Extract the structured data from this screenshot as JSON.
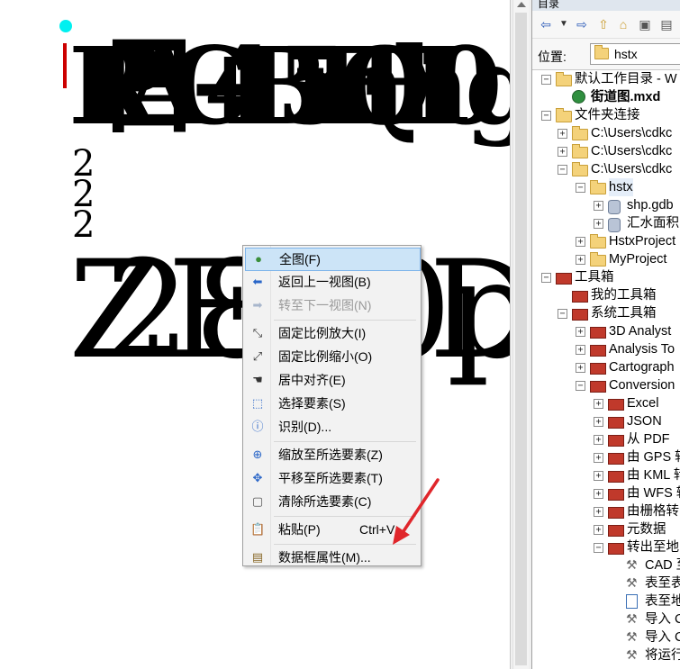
{
  "catalog": {
    "title": "目录",
    "location_label": "位置:",
    "location_value": "hstx",
    "tree": [
      {
        "label": "默认工作目录 - W",
        "level": 0,
        "expander": "−",
        "icon": "home-folder-icon"
      },
      {
        "label": "街道图.mxd",
        "level": 1,
        "expander": "",
        "icon": "map-document-icon",
        "bold": true
      },
      {
        "label": "文件夹连接",
        "level": 0,
        "expander": "−",
        "icon": "folder-connections-icon"
      },
      {
        "label": "C:\\Users\\cdkc",
        "level": 1,
        "expander": "+",
        "icon": "folder-icon"
      },
      {
        "label": "C:\\Users\\cdkc",
        "level": 1,
        "expander": "+",
        "icon": "folder-icon"
      },
      {
        "label": "C:\\Users\\cdkc",
        "level": 1,
        "expander": "−",
        "icon": "folder-icon"
      },
      {
        "label": "hstx",
        "level": 2,
        "expander": "−",
        "icon": "folder-open-icon",
        "selected": true
      },
      {
        "label": "shp.gdb",
        "level": 3,
        "expander": "+",
        "icon": "geodatabase-icon"
      },
      {
        "label": "汇水面积",
        "level": 3,
        "expander": "+",
        "icon": "dataset-icon"
      },
      {
        "label": "HstxProject",
        "level": 2,
        "expander": "+",
        "icon": "folder-icon"
      },
      {
        "label": "MyProject",
        "level": 2,
        "expander": "+",
        "icon": "folder-icon"
      },
      {
        "label": "工具箱",
        "level": 0,
        "expander": "−",
        "icon": "toolbox-icon"
      },
      {
        "label": "我的工具箱",
        "level": 1,
        "expander": "",
        "icon": "toolbox-icon"
      },
      {
        "label": "系统工具箱",
        "level": 1,
        "expander": "−",
        "icon": "toolbox-icon"
      },
      {
        "label": "3D Analyst",
        "level": 2,
        "expander": "+",
        "icon": "toolbox-icon"
      },
      {
        "label": "Analysis To",
        "level": 2,
        "expander": "+",
        "icon": "toolbox-icon"
      },
      {
        "label": "Cartograph",
        "level": 2,
        "expander": "+",
        "icon": "toolbox-icon"
      },
      {
        "label": "Conversion",
        "level": 2,
        "expander": "−",
        "icon": "toolbox-icon"
      },
      {
        "label": "Excel",
        "level": 3,
        "expander": "+",
        "icon": "toolset-icon"
      },
      {
        "label": "JSON",
        "level": 3,
        "expander": "+",
        "icon": "toolset-icon"
      },
      {
        "label": "从 PDF",
        "level": 3,
        "expander": "+",
        "icon": "toolset-icon"
      },
      {
        "label": "由 GPS 转",
        "level": 3,
        "expander": "+",
        "icon": "toolset-icon"
      },
      {
        "label": "由 KML 转",
        "level": 3,
        "expander": "+",
        "icon": "toolset-icon"
      },
      {
        "label": "由 WFS 转",
        "level": 3,
        "expander": "+",
        "icon": "toolset-icon"
      },
      {
        "label": "由栅格转",
        "level": 3,
        "expander": "+",
        "icon": "toolset-icon"
      },
      {
        "label": "元数据",
        "level": 3,
        "expander": "+",
        "icon": "toolset-icon"
      },
      {
        "label": "转出至地",
        "level": 3,
        "expander": "−",
        "icon": "toolset-icon"
      },
      {
        "label": "CAD 至",
        "level": 4,
        "expander": "",
        "icon": "hammer-icon"
      },
      {
        "label": "表至表",
        "level": 4,
        "expander": "",
        "icon": "hammer-icon"
      },
      {
        "label": "表至地",
        "level": 4,
        "expander": "",
        "icon": "script-icon"
      },
      {
        "label": "导入 C",
        "level": 4,
        "expander": "",
        "icon": "hammer-icon"
      },
      {
        "label": "导入 C",
        "level": 4,
        "expander": "",
        "icon": "hammer-icon"
      },
      {
        "label": "将运行",
        "level": 4,
        "expander": "",
        "icon": "hammer-icon"
      }
    ]
  },
  "context_menu": {
    "items": [
      {
        "label": "全图(F)",
        "icon": "globe-icon",
        "highlight": true
      },
      {
        "label": "返回上一视图(B)",
        "icon": "back-arrow-icon"
      },
      {
        "label": "转至下一视图(N)",
        "icon": "forward-arrow-icon",
        "disabled": true
      },
      {
        "sep": true
      },
      {
        "label": "固定比例放大(I)",
        "icon": "fixed-zoom-in-icon"
      },
      {
        "label": "固定比例缩小(O)",
        "icon": "fixed-zoom-out-icon"
      },
      {
        "label": "居中对齐(E)",
        "icon": "pan-hand-icon"
      },
      {
        "label": "选择要素(S)",
        "icon": "select-features-icon"
      },
      {
        "label": "识别(D)...",
        "icon": "identify-icon"
      },
      {
        "sep": true
      },
      {
        "label": "缩放至所选要素(Z)",
        "icon": "zoom-to-selected-icon"
      },
      {
        "label": "平移至所选要素(T)",
        "icon": "pan-to-selected-icon"
      },
      {
        "label": "清除所选要素(C)",
        "icon": "clear-selection-icon"
      },
      {
        "sep": true
      },
      {
        "label": "粘贴(P)",
        "shortcut": "Ctrl+V",
        "icon": "paste-icon"
      },
      {
        "sep": true
      },
      {
        "label": "数据框属性(M)...",
        "icon": "data-frame-properties-icon"
      }
    ]
  },
  "colors": {
    "highlight": "#cce4f7",
    "annotation_arrow": "#e0262b",
    "point": "#00f0f0"
  }
}
